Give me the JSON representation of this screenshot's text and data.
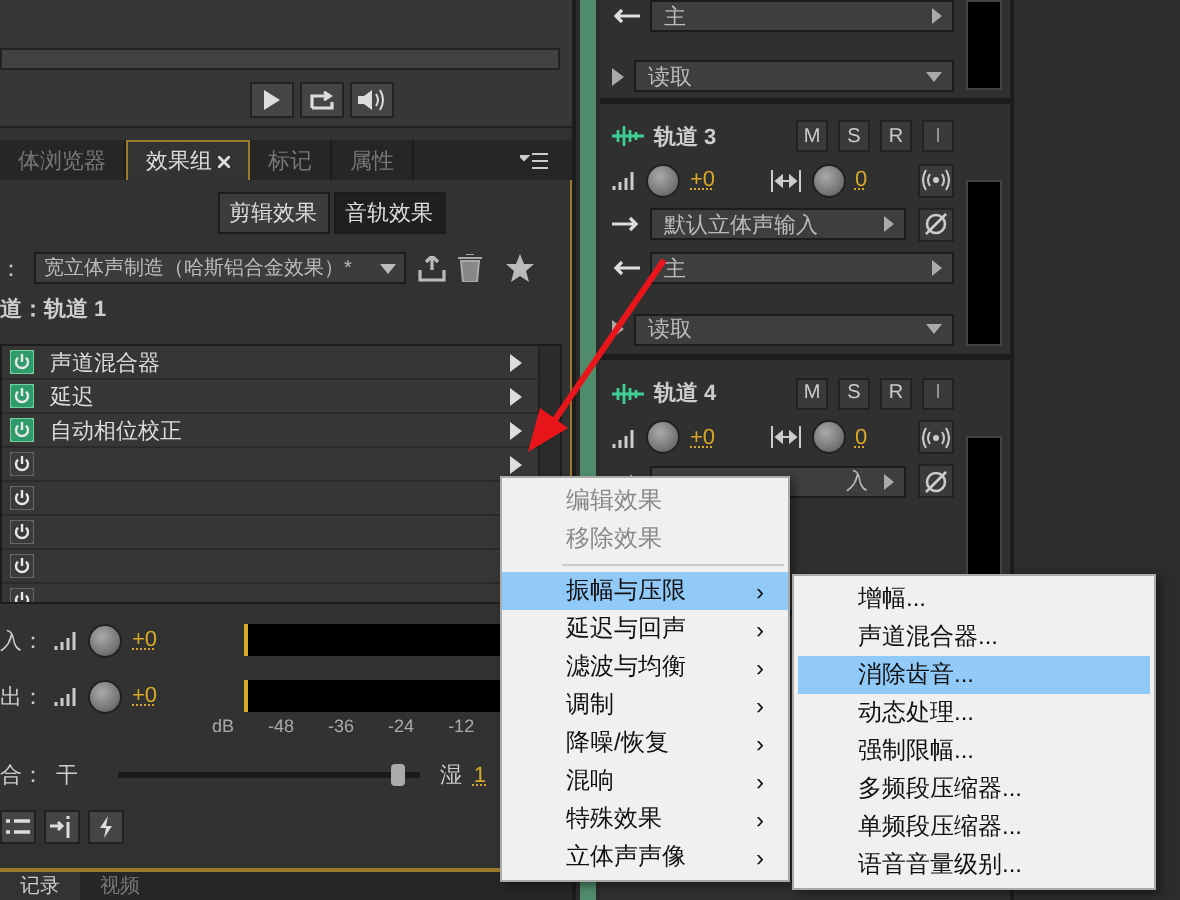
{
  "panel_tabs": [
    {
      "label": "体浏览器",
      "selected": false,
      "closable": false
    },
    {
      "label": "效果组",
      "selected": true,
      "closable": true
    },
    {
      "label": "标记",
      "selected": false,
      "closable": false
    },
    {
      "label": "属性",
      "selected": false,
      "closable": false
    }
  ],
  "effect_type_buttons": [
    {
      "label": "剪辑效果",
      "selected": false
    },
    {
      "label": "音轨效果",
      "selected": true
    }
  ],
  "preset": {
    "label": "：",
    "value": "宽立体声制造（哈斯铝合金效果）*"
  },
  "track_label": "道：轨道 1",
  "effects": [
    {
      "name": "声道混合器",
      "on": true
    },
    {
      "name": "延迟",
      "on": true
    },
    {
      "name": "自动相位校正",
      "on": true
    },
    {
      "on": false
    },
    {
      "on": false
    },
    {
      "on": false
    },
    {
      "on": false
    },
    {
      "on": false
    }
  ],
  "input_gain": {
    "label": "入：",
    "value": "+0"
  },
  "output_gain": {
    "label": "出：",
    "value": "+0"
  },
  "meter_scale": [
    "dB",
    "-48",
    "-36",
    "-24",
    "-12"
  ],
  "mix": {
    "label": "合：",
    "dry": "干",
    "wet": "湿",
    "value": "1",
    "level": 0.93
  },
  "bottom_tabs": [
    {
      "label": "记录",
      "selected": true
    },
    {
      "label": "视频",
      "selected": false
    }
  ],
  "tracks": [
    {
      "output": "主",
      "automation": "读取"
    },
    {
      "name": "轨道 3",
      "volume": "+0",
      "pan": "0",
      "input": "默认立体声输入",
      "output": "主",
      "automation": "读取",
      "buttons": [
        "M",
        "S",
        "R",
        "I"
      ]
    },
    {
      "name": "轨道 4",
      "volume": "+0",
      "pan": "0",
      "input": "入",
      "buttons": [
        "M",
        "S",
        "R",
        "I"
      ]
    }
  ],
  "context_menu": {
    "items": [
      {
        "kind": "action",
        "label": "编辑效果",
        "disabled": true
      },
      {
        "kind": "action",
        "label": "移除效果",
        "disabled": true
      },
      {
        "kind": "separator"
      },
      {
        "kind": "submenu",
        "label": "振幅与压限",
        "selected": true
      },
      {
        "kind": "submenu",
        "label": "延迟与回声",
        "selected": false
      },
      {
        "kind": "submenu",
        "label": "滤波与均衡",
        "selected": false
      },
      {
        "kind": "submenu",
        "label": "调制",
        "selected": false
      },
      {
        "kind": "submenu",
        "label": "降噪/恢复",
        "selected": false
      },
      {
        "kind": "submenu",
        "label": "混响",
        "selected": false
      },
      {
        "kind": "submenu",
        "label": "特殊效果",
        "selected": false
      },
      {
        "kind": "submenu",
        "label": "立体声声像",
        "selected": false
      }
    ],
    "submenu_arrow": "›"
  },
  "submenu": {
    "items": [
      {
        "label": "增幅...",
        "selected": false
      },
      {
        "label": "声道混合器...",
        "selected": false
      },
      {
        "label": "消除齿音...",
        "selected": true
      },
      {
        "label": "动态处理...",
        "selected": false
      },
      {
        "label": "强制限幅...",
        "selected": false
      },
      {
        "label": "多频段压缩器...",
        "selected": false
      },
      {
        "label": "单频段压缩器...",
        "selected": false
      },
      {
        "label": "语音音量级别...",
        "selected": false
      }
    ]
  }
}
